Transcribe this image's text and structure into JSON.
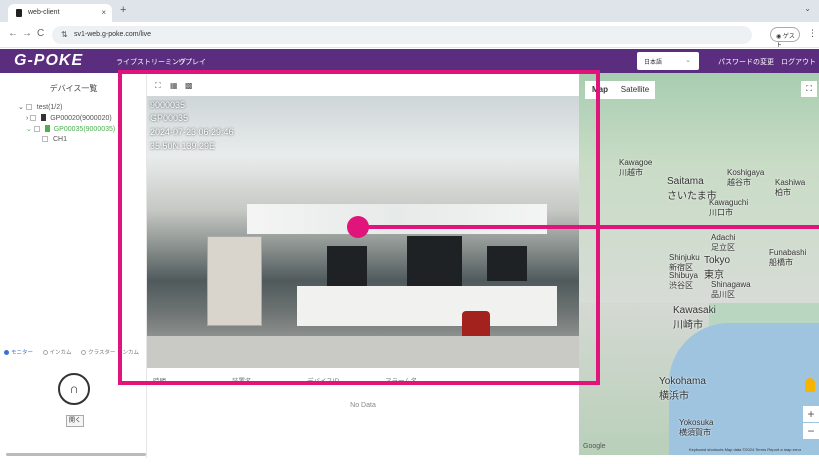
{
  "browser": {
    "tab_title": "web-client",
    "tab_close": "×",
    "new_tab": "+",
    "tab_menu": "⌄",
    "url": "sv1-web.g-poke.com/live",
    "guest_label": "ゲスト",
    "back": "←",
    "forward": "→",
    "reload": "C",
    "more": "⋮"
  },
  "header": {
    "logo": "G-POKE",
    "nav": [
      "ライブストリーミング",
      "リプレイ"
    ],
    "language": "日本語",
    "change_password": "パスワードの変更",
    "logout": "ログアウト"
  },
  "sidebar": {
    "title": "デバイス一覧",
    "tree": [
      {
        "label": "test(1/2)",
        "selected": false
      },
      {
        "label": "GP00020(9000020)",
        "selected": false
      },
      {
        "label": "GP00035(9000035)",
        "selected": true
      },
      {
        "label": "CH1",
        "selected": false
      }
    ],
    "modes": [
      "モニター",
      "インカム",
      "クラスター インカム"
    ],
    "open_button": "開く"
  },
  "player": {
    "osd_lines": [
      "9000035",
      "GP00035",
      "2024-07-23 06:29:46",
      "35.50N 139.29E"
    ]
  },
  "alarm_table": {
    "columns": [
      "時間",
      "装置名",
      "デバイスID",
      "アラーム名"
    ],
    "empty_text": "No Data"
  },
  "map": {
    "tabs": [
      "Map",
      "Satellite"
    ],
    "labels": [
      {
        "text": "Kawagoe",
        "sub": "川越市"
      },
      {
        "text": "Saitama",
        "sub": "さいたま市"
      },
      {
        "text": "Koshigaya",
        "sub": "越谷市"
      },
      {
        "text": "Kashiwa",
        "sub": "柏市"
      },
      {
        "text": "Kawaguchi",
        "sub": "川口市"
      },
      {
        "text": "Adachi",
        "sub": "足立区"
      },
      {
        "text": "Funabashi",
        "sub": "船橋市"
      },
      {
        "text": "Tokyo",
        "sub": "東京"
      },
      {
        "text": "Shinjuku",
        "sub": "新宿区"
      },
      {
        "text": "Shibuya",
        "sub": "渋谷区"
      },
      {
        "text": "Shinagawa",
        "sub": "品川区"
      },
      {
        "text": "Kawasaki",
        "sub": "川崎市"
      },
      {
        "text": "Yokohama",
        "sub": "横浜市"
      },
      {
        "text": "Yokosuka",
        "sub": "横須賀市"
      }
    ],
    "zoom_in": "+",
    "zoom_out": "−",
    "google": "Google",
    "attribution": "Keyboard shortcuts   Map data ©2024   Terms   Report a map error"
  }
}
